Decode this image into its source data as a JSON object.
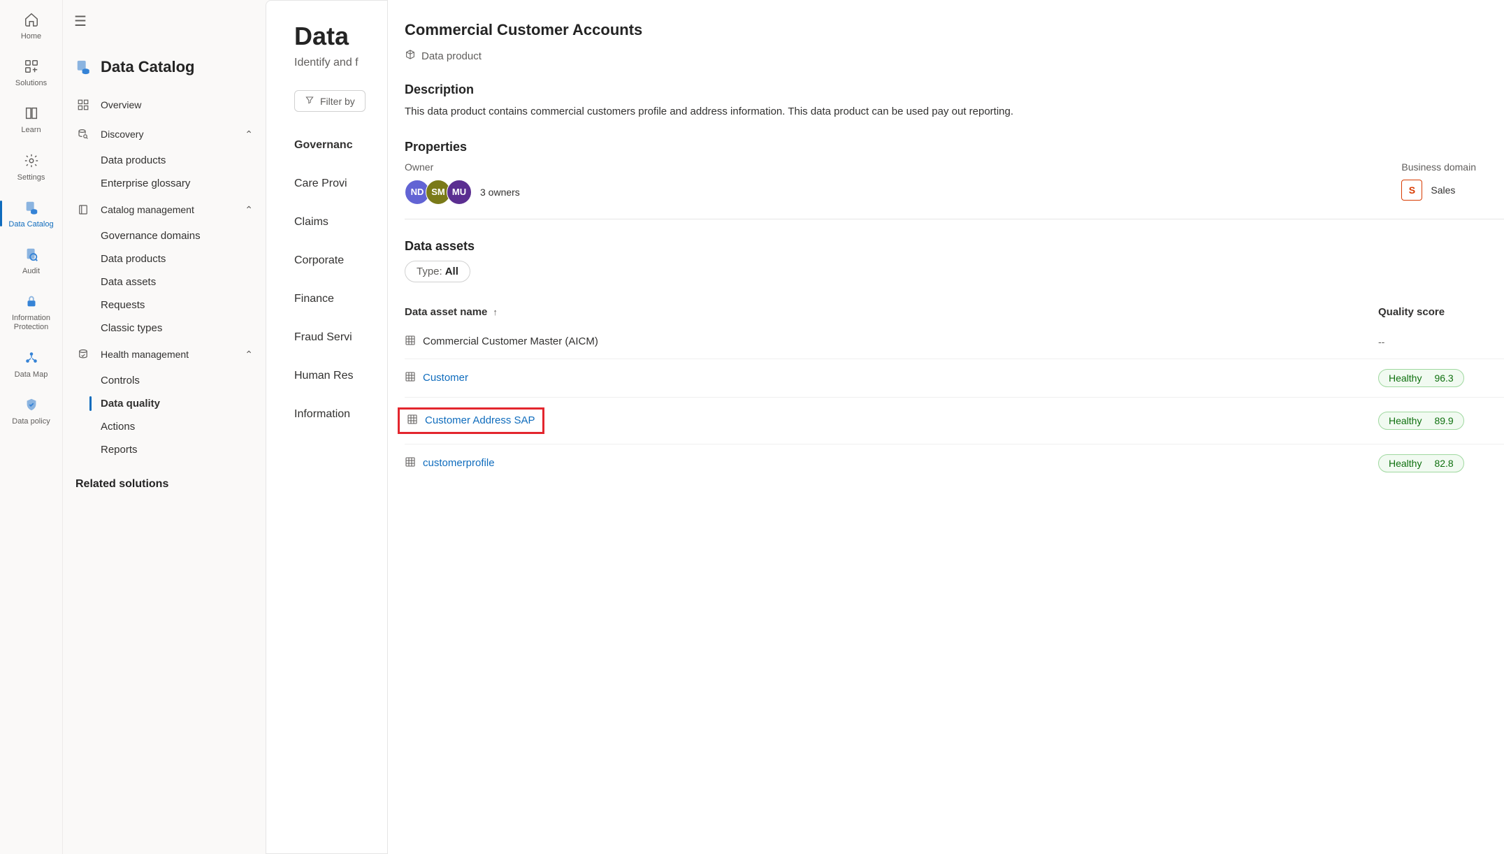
{
  "rail": [
    {
      "id": "home",
      "label": "Home"
    },
    {
      "id": "solutions",
      "label": "Solutions"
    },
    {
      "id": "learn",
      "label": "Learn"
    },
    {
      "id": "settings",
      "label": "Settings"
    },
    {
      "id": "data-catalog",
      "label": "Data Catalog",
      "active": true
    },
    {
      "id": "audit",
      "label": "Audit"
    },
    {
      "id": "info-protection",
      "label": "Information Protection"
    },
    {
      "id": "data-map",
      "label": "Data Map"
    },
    {
      "id": "data-policy",
      "label": "Data policy"
    }
  ],
  "sidebar": {
    "title": "Data Catalog",
    "overview": "Overview",
    "discovery": {
      "label": "Discovery",
      "items": [
        "Data products",
        "Enterprise glossary"
      ]
    },
    "catalog_mgmt": {
      "label": "Catalog management",
      "items": [
        "Governance domains",
        "Data products",
        "Data assets",
        "Requests",
        "Classic types"
      ]
    },
    "health_mgmt": {
      "label": "Health management",
      "items": [
        "Controls",
        "Data quality",
        "Actions",
        "Reports"
      ],
      "active_index": 1
    },
    "related": "Related solutions"
  },
  "main": {
    "title_partial": "Data ",
    "subtitle_partial": "Identify and f",
    "filter_label": "Filter by",
    "gov_header": "Governanc",
    "gov_items": [
      "Care Provi",
      "Claims",
      "Corporate ",
      "Finance",
      "Fraud Servi",
      "Human Res",
      "Information"
    ]
  },
  "panel": {
    "title": "Commercial Customer Accounts",
    "product_tag": "Data product",
    "description_label": "Description",
    "description": "This data product contains commercial customers profile and address information. This data product can be used pay out reporting.",
    "properties_label": "Properties",
    "owner_label": "Owner",
    "owners": [
      {
        "initials": "ND",
        "color": "#6264d4"
      },
      {
        "initials": "SM",
        "color": "#7a7a19"
      },
      {
        "initials": "MU",
        "color": "#5b2e91"
      }
    ],
    "owners_count": "3 owners",
    "business_domain_label": "Business domain",
    "business_domain_initial": "S",
    "business_domain": "Sales",
    "data_assets_label": "Data assets",
    "type_filter_prefix": "Type: ",
    "type_filter_value": "All",
    "col_name": "Data asset name",
    "col_score": "Quality score",
    "assets": [
      {
        "name": "Commercial Customer Master (AICM)",
        "link": false,
        "score": null,
        "highlighted": false
      },
      {
        "name": "Customer",
        "link": true,
        "score": {
          "label": "Healthy",
          "value": "96.3"
        },
        "highlighted": false
      },
      {
        "name": "Customer Address SAP",
        "link": true,
        "score": {
          "label": "Healthy",
          "value": "89.9"
        },
        "highlighted": true
      },
      {
        "name": "customerprofile",
        "link": true,
        "score": {
          "label": "Healthy",
          "value": "82.8"
        },
        "highlighted": false
      }
    ],
    "no_score": "--"
  }
}
